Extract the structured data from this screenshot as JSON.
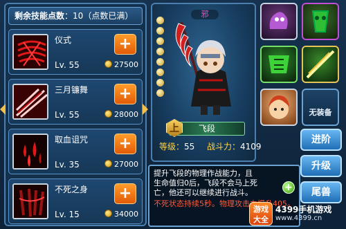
{
  "skill_points": {
    "label": "剩余技能点数",
    "value": "10",
    "note": "（点数已满）"
  },
  "skills": [
    {
      "name": "仪式",
      "level": "Lv. 55",
      "cost": "27500",
      "icon": "ritual-icon"
    },
    {
      "name": "三月镰舞",
      "level": "Lv. 55",
      "cost": "28000",
      "icon": "scythe-dance-icon"
    },
    {
      "name": "取血诅咒",
      "level": "Lv. 35",
      "cost": "27000",
      "icon": "blood-curse-icon"
    },
    {
      "name": "不死之身",
      "level": "Lv. 15",
      "cost": "34000",
      "icon": "undying-body-icon"
    }
  ],
  "character": {
    "name": "飞段",
    "emblem": "邪",
    "rank": "上"
  },
  "stats": {
    "level_label": "等级：",
    "level": "55",
    "power_label": "战斗力：",
    "power": "4109"
  },
  "items": {
    "blank_label": "无装备"
  },
  "buttons": {
    "advance": "进阶",
    "upgrade": "升级",
    "spirit": "尾兽"
  },
  "tooltip": {
    "main": "提升飞段的物理作战能力，且生命值归0后，飞段不会马上死亡，他还可以继续进行战斗。",
    "sub": "不死状态持续5秒。物理攻击力提升405。"
  },
  "watermark": {
    "logo_line1": "游戏",
    "logo_line2": "大全",
    "title": "4399手机游戏",
    "url": "www.4399.cn"
  },
  "colors": {
    "accent": "#ff8a1f",
    "panel_border": "#4a7fb0",
    "tooltip_highlight": "#ff5a3a"
  }
}
